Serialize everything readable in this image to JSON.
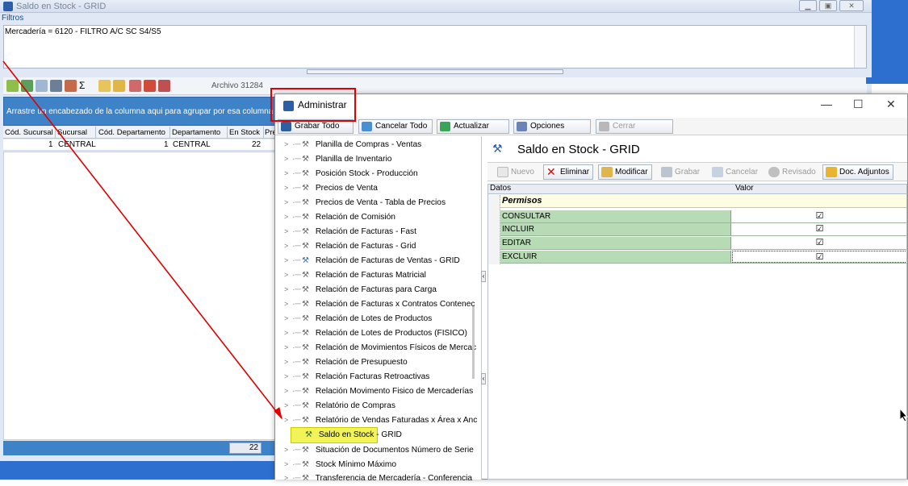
{
  "background_window": {
    "title": "Saldo en Stock - GRID",
    "filters_label": "Filtros",
    "filter_text": "Mercadería = 6120 - FILTRO A/C SC S4/S5",
    "archivo": "Archivo 31284",
    "group_hint": "Arrastre un encabezado de la columna aqui para agrupar por esa columna",
    "columns": [
      "Cód. Sucursal",
      "Sucursal",
      "Cód. Departamento",
      "Departamento",
      "En Stock",
      "Pre"
    ],
    "row": [
      "1",
      "CENTRAL",
      "1",
      "CENTRAL",
      "22"
    ],
    "footer_total": "22"
  },
  "admin_window": {
    "title": "Administrar",
    "toolbar": {
      "grabar_todo": "Grabar Todo",
      "cancelar_todo": "Cancelar Todo",
      "actualizar": "Actualizar",
      "opciones": "Opciones",
      "cerrar": "Cerrar"
    },
    "tree_items": [
      "Planilla de Compras - Ventas",
      "Planilla de Inventario",
      "Posición Stock - Producción",
      "Precios de Venta",
      "Precios de Venta - Tabla de Precios",
      "Relación de Comisión",
      "Relación de Facturas - Fast",
      "Relación de Facturas - Grid",
      "Relación de Facturas de Ventas - GRID",
      "Relación de Facturas Matricial",
      "Relación de Facturas para Carga",
      "Relación de Facturas x Contratos Contenec",
      "Relación de Lotes de Productos",
      "Relación de Lotes de Productos (FISICO)",
      "Relación de Movimientos Físicos de Mercac",
      "Relación de Presupuesto",
      "Relación Facturas Retroactivas",
      "Relación Movimento Fisico de Mercaderías",
      "Relatório de Compras",
      "Relatório de Vendas Faturadas x Área x Anc",
      "Saldo en Stock - GRID",
      "Situación de Documentos Número de Serie",
      "Stock Mínimo Máximo",
      "Transferencia de Mercadería - Conferencia"
    ],
    "selected_index": 20,
    "panel": {
      "title": "Saldo en Stock - GRID",
      "buttons": {
        "nuevo": "Nuevo",
        "eliminar": "Eliminar",
        "modificar": "Modificar",
        "grabar": "Grabar",
        "cancelar": "Cancelar",
        "revisado": "Revisado",
        "doc_adjuntos": "Doc. Adjuntos"
      },
      "headers": {
        "datos": "Datos",
        "valor": "Valor"
      },
      "group": "Permisos",
      "permissions": [
        {
          "name": "CONSULTAR",
          "value": "☑"
        },
        {
          "name": "INCLUIR",
          "value": "☑"
        },
        {
          "name": "EDITAR",
          "value": "☑"
        },
        {
          "name": "EXCLUIR",
          "value": "☑"
        }
      ]
    }
  },
  "colors": {
    "desktop_blue": "#2d6fcf",
    "grid_group_bar": "#3e82c8",
    "permission_row": "#b7dcb5",
    "annotation_red": "#e00000",
    "highlight_yellow": "#f0f03c"
  }
}
